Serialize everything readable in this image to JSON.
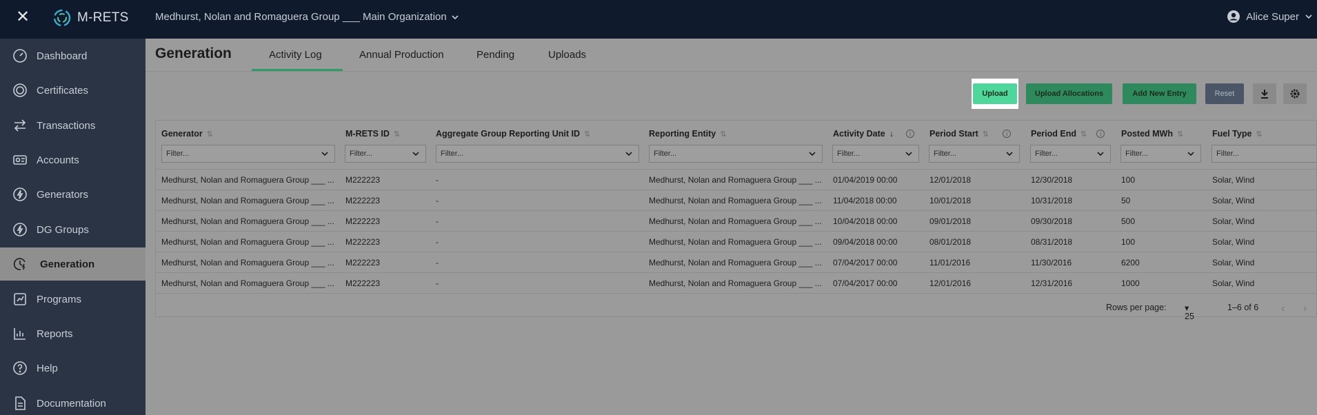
{
  "topbar": {
    "logo_text": "M-RETS",
    "organization": "Medhurst, Nolan and Romaguera Group ___ Main Organization",
    "user_name": "Alice Super"
  },
  "sidebar": {
    "items": [
      {
        "label": "Dashboard",
        "icon": "dashboard-icon"
      },
      {
        "label": "Certificates",
        "icon": "certificate-icon"
      },
      {
        "label": "Transactions",
        "icon": "transfer-arrows-icon"
      },
      {
        "label": "Accounts",
        "icon": "accounts-icon"
      },
      {
        "label": "Generators",
        "icon": "lightning-icon"
      },
      {
        "label": "DG Groups",
        "icon": "lightning-icon"
      },
      {
        "label": "Generation",
        "icon": "clock-lightning-icon",
        "active": true
      },
      {
        "label": "Programs",
        "icon": "programs-icon"
      },
      {
        "label": "Reports",
        "icon": "reports-icon"
      },
      {
        "label": "Help",
        "icon": "help-icon"
      },
      {
        "label": "Documentation",
        "icon": "document-icon"
      }
    ]
  },
  "page": {
    "title": "Generation",
    "tabs": [
      "Activity Log",
      "Annual Production",
      "Pending",
      "Uploads"
    ],
    "active_tab": "Activity Log"
  },
  "toolbar": {
    "upload": "Upload",
    "upload_allocations": "Upload Allocations",
    "add_new_entry": "Add New Entry",
    "reset": "Reset"
  },
  "table": {
    "columns": [
      "Generator",
      "M-RETS ID",
      "Aggregate Group Reporting Unit ID",
      "Reporting Entity",
      "Activity Date",
      "Period Start",
      "Period End",
      "Posted MWh",
      "Fuel Type"
    ],
    "filter_placeholder": "Filter...",
    "rows": [
      [
        "Medhurst, Nolan and Romaguera Group ___ ...",
        "M222223",
        "-",
        "Medhurst, Nolan and Romaguera Group ___ ...",
        "01/04/2019 00:00",
        "12/01/2018",
        "12/30/2018",
        "100",
        "Solar, Wind"
      ],
      [
        "Medhurst, Nolan and Romaguera Group ___ ...",
        "M222223",
        "-",
        "Medhurst, Nolan and Romaguera Group ___ ...",
        "11/04/2018 00:00",
        "10/01/2018",
        "10/31/2018",
        "50",
        "Solar, Wind"
      ],
      [
        "Medhurst, Nolan and Romaguera Group ___ ...",
        "M222223",
        "-",
        "Medhurst, Nolan and Romaguera Group ___ ...",
        "10/04/2018 00:00",
        "09/01/2018",
        "09/30/2018",
        "500",
        "Solar, Wind"
      ],
      [
        "Medhurst, Nolan and Romaguera Group ___ ...",
        "M222223",
        "-",
        "Medhurst, Nolan and Romaguera Group ___ ...",
        "09/04/2018 00:00",
        "08/01/2018",
        "08/31/2018",
        "100",
        "Solar, Wind"
      ],
      [
        "Medhurst, Nolan and Romaguera Group ___ ...",
        "M222223",
        "-",
        "Medhurst, Nolan and Romaguera Group ___ ...",
        "07/04/2017 00:00",
        "11/01/2016",
        "11/30/2016",
        "6200",
        "Solar, Wind"
      ],
      [
        "Medhurst, Nolan and Romaguera Group ___ ...",
        "M222223",
        "-",
        "Medhurst, Nolan and Romaguera Group ___ ...",
        "07/04/2017 00:00",
        "12/01/2016",
        "12/31/2016",
        "1000",
        "Solar, Wind"
      ]
    ]
  },
  "pagination": {
    "rows_per_page_label": "Rows per page:",
    "rows_per_page": "25",
    "range": "1–6 of 6"
  },
  "colors": {
    "topbar": "#0f1b2d",
    "sidebar": "#2a3444",
    "accent": "#4fd69a",
    "button_green": "#2e8a5c"
  }
}
